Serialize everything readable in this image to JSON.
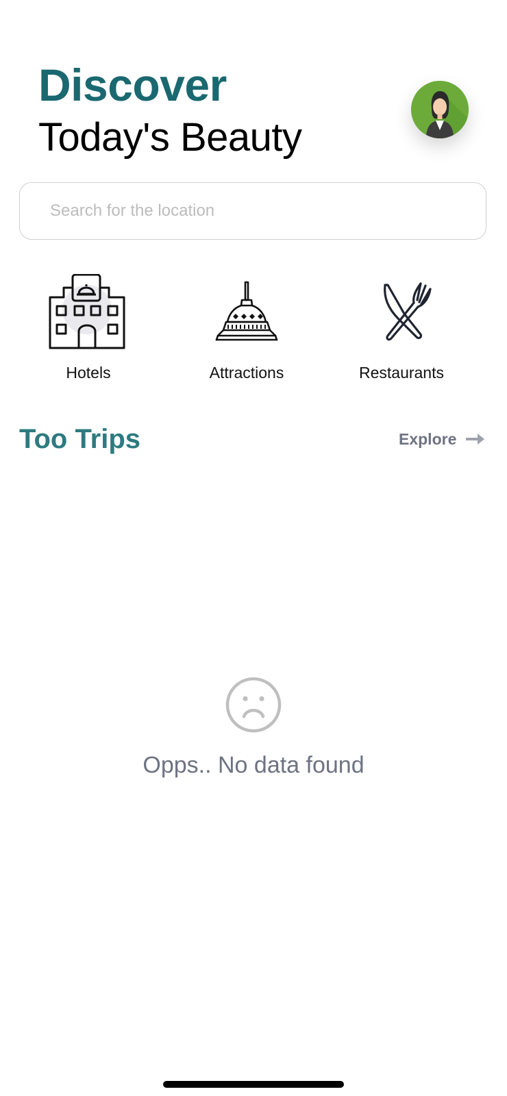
{
  "header": {
    "title": "Discover",
    "subtitle": "Today's Beauty",
    "title_color": "#1a6870",
    "avatar_icon": "person-avatar-icon"
  },
  "search": {
    "placeholder": "Search for the location",
    "value": ""
  },
  "categories": [
    {
      "label": "Hotels",
      "icon": "hotel-building-icon"
    },
    {
      "label": "Attractions",
      "icon": "temple-stupa-icon"
    },
    {
      "label": "Restaurants",
      "icon": "fork-knife-icon"
    }
  ],
  "trips": {
    "title": "Too Trips",
    "explore_label": "Explore",
    "explore_icon": "arrow-right-icon",
    "accent_color": "#2e7a80"
  },
  "empty_state": {
    "icon": "sad-face-icon",
    "message": "Opps.. No data found"
  }
}
